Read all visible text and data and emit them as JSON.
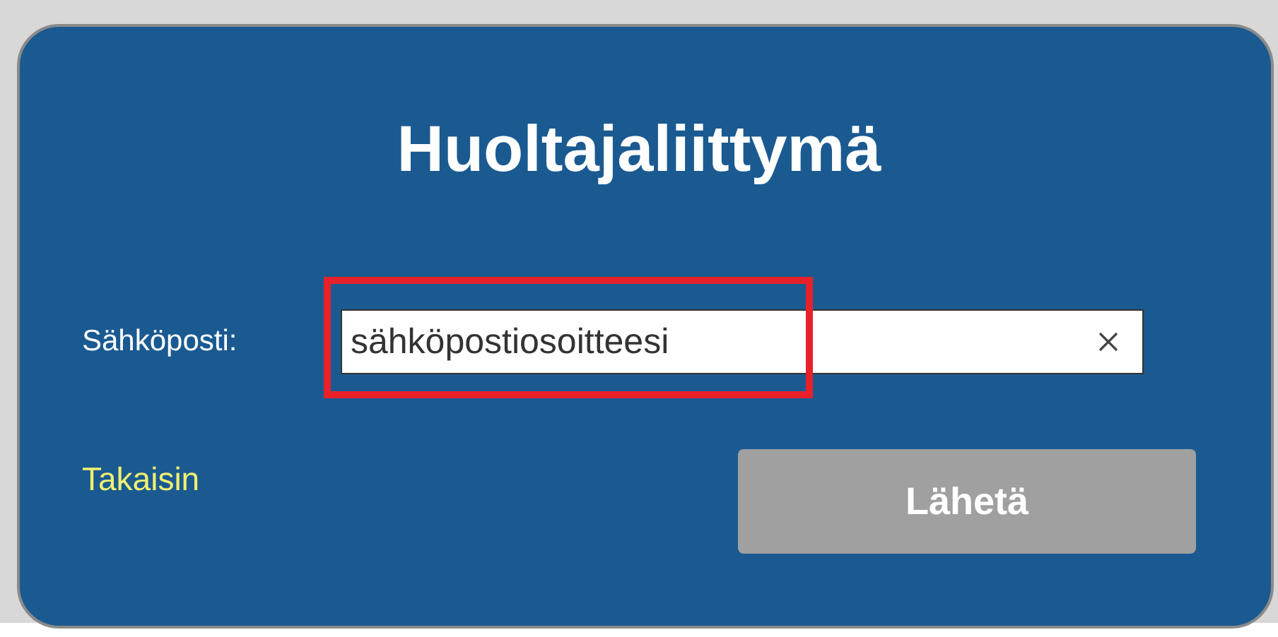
{
  "title": "Huoltajaliittymä",
  "email_field": {
    "label": "Sähköposti:",
    "value": "sähköpostiosoitteesi",
    "highlighted": true
  },
  "back_link": "Takaisin",
  "submit_button": {
    "label": "Lähetä",
    "disabled": true
  }
}
